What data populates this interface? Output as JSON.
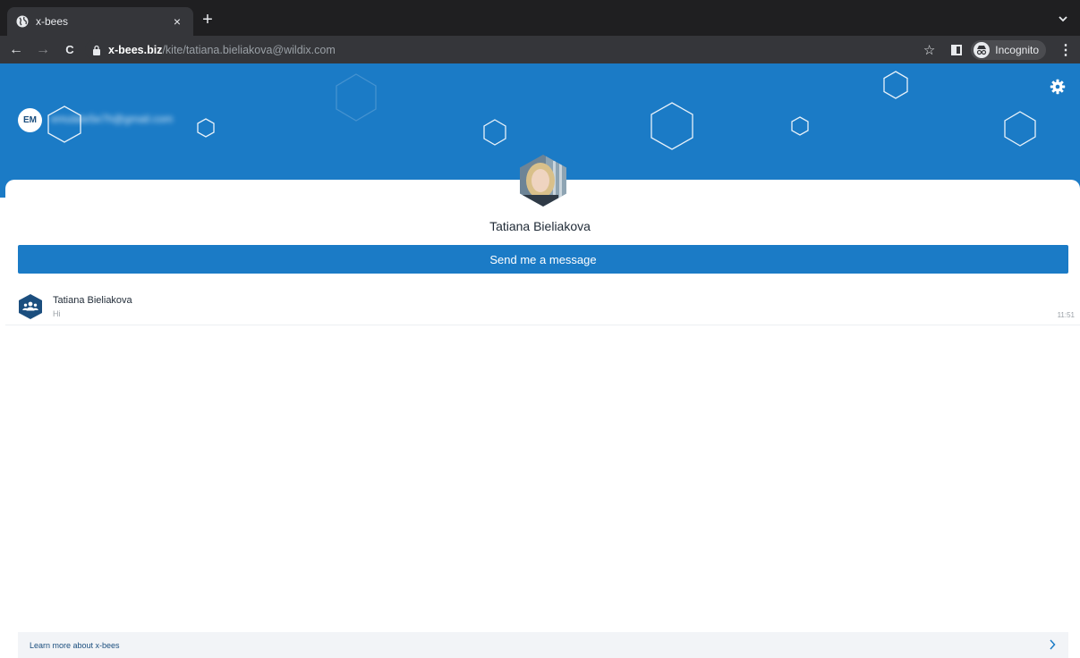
{
  "browser": {
    "tab_title": "x-bees",
    "tab_close": "×",
    "new_tab": "+",
    "url_host": "x-bees.biz",
    "url_path": "/kite/tatiana.bieliakova@wildix.com",
    "incognito_label": "Incognito",
    "back_glyph": "←",
    "forward_glyph": "→",
    "reload_glyph": "C",
    "star_glyph": "☆",
    "menu_glyph": "⋮"
  },
  "header": {
    "user_initials": "EM",
    "user_email": "emulate5e7h@gmail.com",
    "brand_color": "#1b7bc6"
  },
  "profile": {
    "name": "Tatiana Bieliakova",
    "send_button_label": "Send me a message"
  },
  "conversations": [
    {
      "name": "Tatiana Bieliakova",
      "preview": "Hi",
      "time": "11:51"
    }
  ],
  "footer": {
    "learn_more_label": "Learn more about x-bees"
  }
}
